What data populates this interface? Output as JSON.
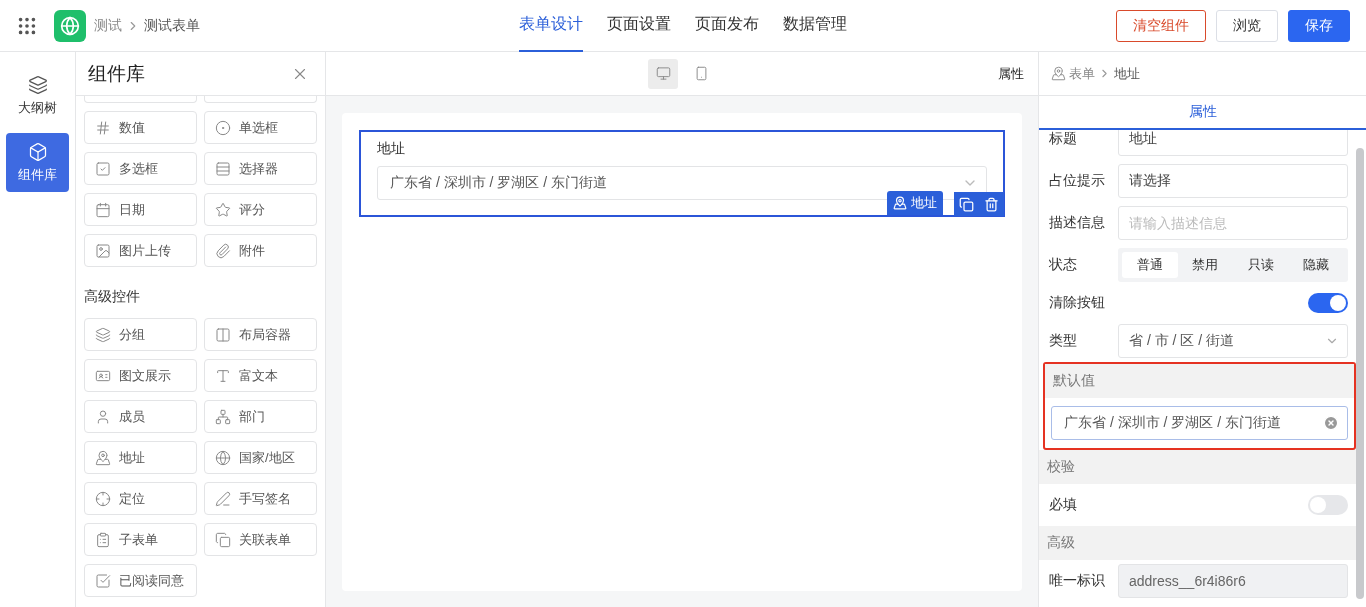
{
  "header": {
    "breadcrumb": [
      "测试",
      "测试表单"
    ],
    "tabs": [
      {
        "label": "表单设计",
        "selected": true
      },
      {
        "label": "页面设置",
        "selected": false
      },
      {
        "label": "页面发布",
        "selected": false
      },
      {
        "label": "数据管理",
        "selected": false
      }
    ],
    "buttons": [
      {
        "label": "清空组件",
        "kind": "danger"
      },
      {
        "label": "浏览",
        "kind": "default"
      },
      {
        "label": "保存",
        "kind": "primary"
      }
    ]
  },
  "rail": {
    "items": [
      {
        "label": "大纲树",
        "kind": "layers",
        "selected": false
      },
      {
        "label": "组件库",
        "kind": "cube",
        "selected": true
      }
    ]
  },
  "library": {
    "title": "组件库",
    "groups": [
      {
        "items": [
          {
            "label": "数值",
            "kind": "number"
          },
          {
            "label": "单选框",
            "kind": "radio"
          },
          {
            "label": "多选框",
            "kind": "checkbox"
          },
          {
            "label": "选择器",
            "kind": "select"
          },
          {
            "label": "日期",
            "kind": "date"
          },
          {
            "label": "评分",
            "kind": "star"
          },
          {
            "label": "图片上传",
            "kind": "image"
          },
          {
            "label": "附件",
            "kind": "attachment"
          }
        ]
      },
      {
        "title": "高级控件",
        "items": [
          {
            "label": "分组",
            "kind": "layers"
          },
          {
            "label": "布局容器",
            "kind": "columns"
          },
          {
            "label": "图文展示",
            "kind": "card"
          },
          {
            "label": "富文本",
            "kind": "text"
          },
          {
            "label": "成员",
            "kind": "user"
          },
          {
            "label": "部门",
            "kind": "tree"
          },
          {
            "label": "地址",
            "kind": "map"
          },
          {
            "label": "国家/地区",
            "kind": "globe"
          },
          {
            "label": "定位",
            "kind": "crosshair"
          },
          {
            "label": "手写签名",
            "kind": "pen"
          },
          {
            "label": "子表单",
            "kind": "list"
          },
          {
            "label": "关联表单",
            "kind": "copy"
          },
          {
            "label": "已阅读同意",
            "kind": "agree"
          }
        ]
      }
    ]
  },
  "canvas": {
    "devices": [
      {
        "kind": "desktop",
        "selected": true
      },
      {
        "kind": "mobile",
        "selected": false
      }
    ],
    "toolbar_label": "属性",
    "field": {
      "label": "地址",
      "value": "广东省 / 深圳市 / 罗湖区 / 东门街道",
      "tag": "地址",
      "selected": true
    }
  },
  "properties": {
    "breadcrumb": [
      "表单",
      "地址"
    ],
    "tab": {
      "label": "属性",
      "selected": true
    },
    "rows": [
      {
        "kind": "input",
        "label": "标题",
        "value": "地址"
      },
      {
        "kind": "input",
        "label": "占位提示",
        "value": "请选择"
      },
      {
        "kind": "input",
        "label": "描述信息",
        "placeholder": "请输入描述信息"
      },
      {
        "kind": "segmented",
        "label": "状态",
        "options": [
          {
            "label": "普通",
            "selected": true
          },
          {
            "label": "禁用",
            "selected": false
          },
          {
            "label": "只读",
            "selected": false
          },
          {
            "label": "隐藏",
            "selected": false
          }
        ]
      },
      {
        "kind": "switch",
        "label": "清除按钮",
        "on": true
      },
      {
        "kind": "select",
        "label": "类型",
        "value": "省 / 市 / 区 / 街道"
      },
      {
        "kind": "section",
        "title": "默认值",
        "highlighted": true,
        "value": "广东省 / 深圳市 / 罗湖区 / 东门街道"
      },
      {
        "kind": "section",
        "title": "校验",
        "highlighted": false
      },
      {
        "kind": "switch",
        "label": "必填",
        "on": false
      },
      {
        "kind": "section",
        "title": "高级",
        "highlighted": false
      },
      {
        "kind": "input",
        "label": "唯一标识",
        "value": "address__6r4i86r6",
        "disabled": true
      }
    ]
  }
}
